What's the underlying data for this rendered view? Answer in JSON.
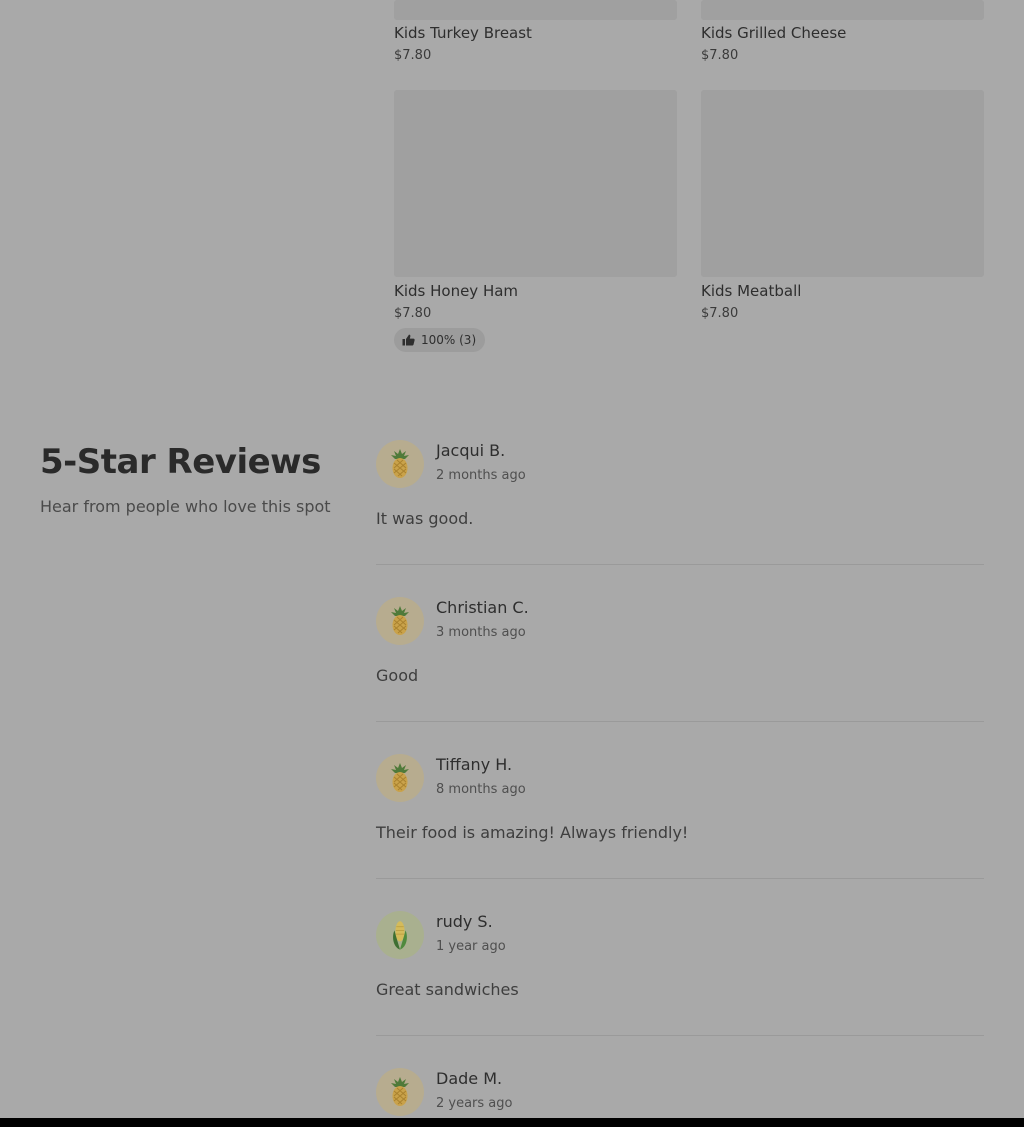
{
  "menu": {
    "items": [
      {
        "name": "Kids Turkey Breast",
        "price": "$7.80"
      },
      {
        "name": "Kids Grilled Cheese",
        "price": "$7.80"
      },
      {
        "name": "Kids Honey Ham",
        "price": "$7.80",
        "rating": "100% (3)",
        "rating_icon": "thumbs-up-icon"
      },
      {
        "name": "Kids Meatball",
        "price": "$7.80"
      }
    ]
  },
  "reviews_section": {
    "title": "5-Star Reviews",
    "subtitle": "Hear from people who love this spot",
    "reviews": [
      {
        "name": "Jacqui B.",
        "time": "2 months ago",
        "text": "It was good.",
        "avatar": "pineapple-icon"
      },
      {
        "name": "Christian C.",
        "time": "3 months ago",
        "text": "Good",
        "avatar": "pineapple-icon"
      },
      {
        "name": "Tiffany H.",
        "time": "8 months ago",
        "text": "Their food is amazing! Always friendly!",
        "avatar": "pineapple-icon"
      },
      {
        "name": "rudy S.",
        "time": "1 year ago",
        "text": "Great sandwiches",
        "avatar": "corn-icon"
      },
      {
        "name": "Dade M.",
        "time": "2 years ago",
        "avatar": "pineapple-icon"
      }
    ]
  },
  "colors": {
    "overlay_background": "#a9a9a9",
    "image_placeholder": "#a0a0a0",
    "text": "#2c2c2c",
    "avatar_background": "#b7ac8f"
  }
}
